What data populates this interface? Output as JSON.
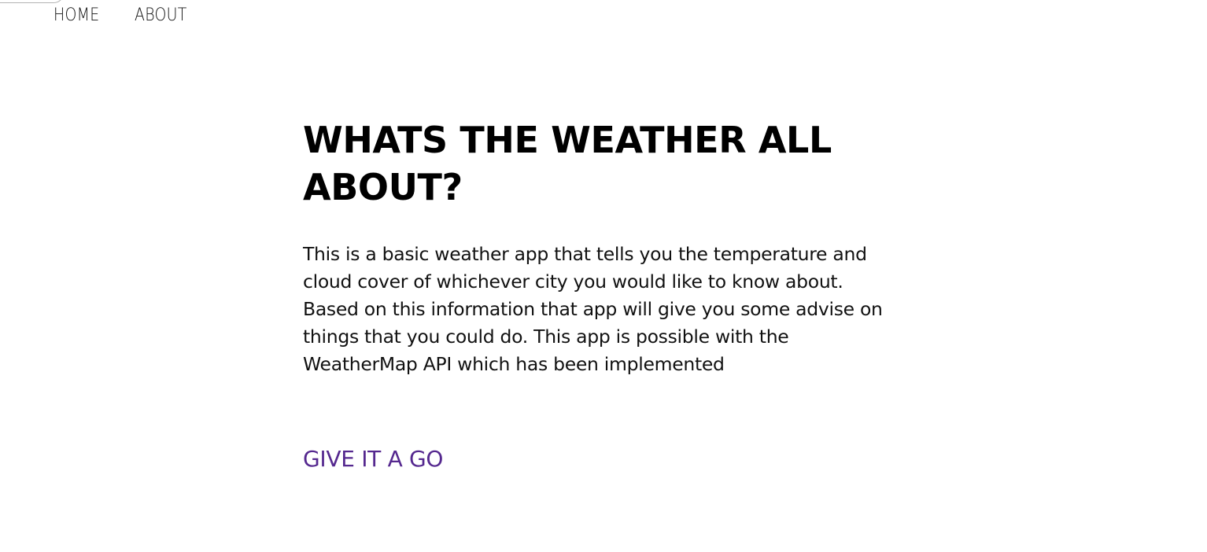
{
  "nav": {
    "items": [
      {
        "label": "HOME"
      },
      {
        "label": "ABOUT"
      }
    ]
  },
  "main": {
    "title": "WHATS THE WEATHER ALL ABOUT?",
    "description": "This is a basic weather app that tells you the temperature and cloud cover of whichever city you would like to know about. Based on this information that app will give you some advise on things that you could do. This app is possible with the WeatherMap API which has been implemented",
    "cta_label": "GIVE IT A GO"
  },
  "colors": {
    "cta": "#55288f",
    "text": "#000000",
    "background": "#ffffff"
  }
}
